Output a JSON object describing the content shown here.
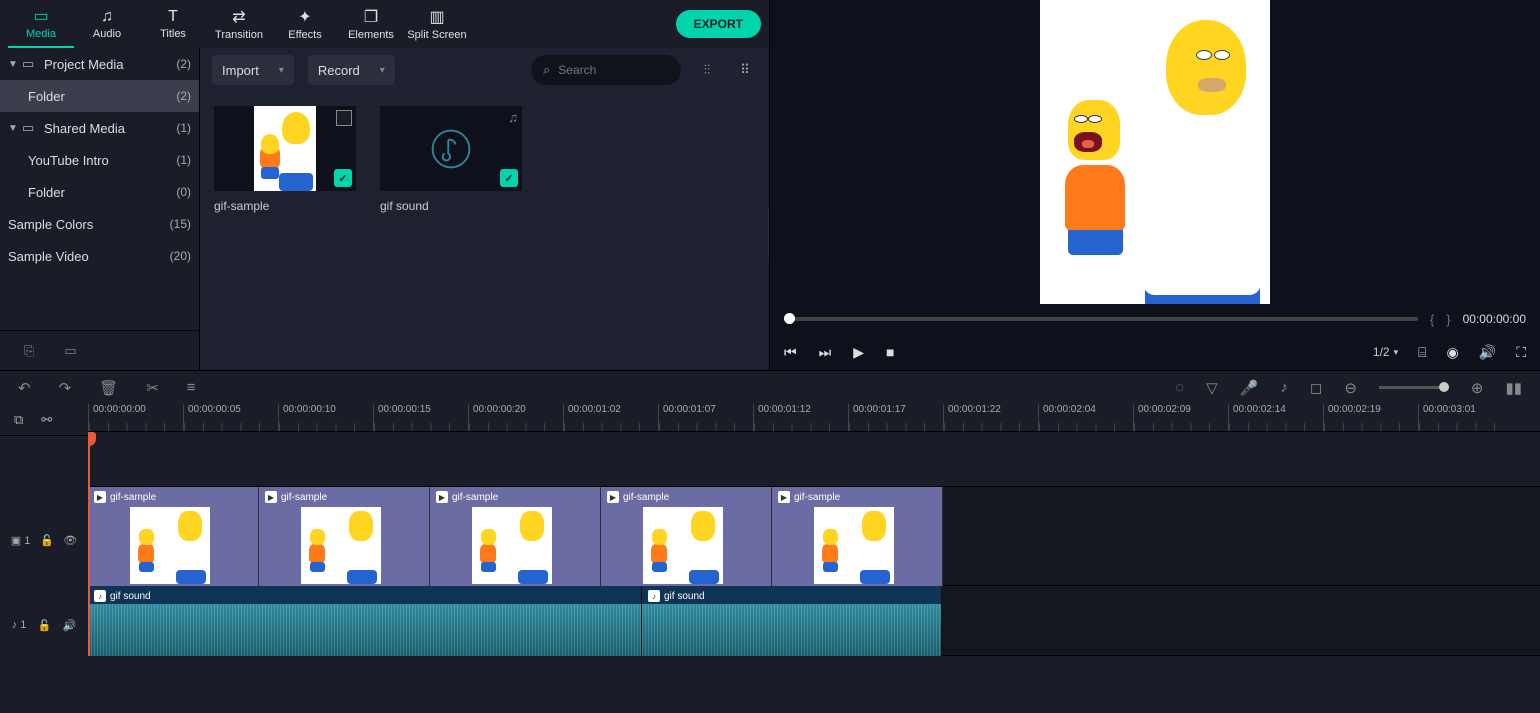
{
  "tabs": [
    {
      "label": "Media",
      "icon": "folder"
    },
    {
      "label": "Audio",
      "icon": "music"
    },
    {
      "label": "Titles",
      "icon": "text"
    },
    {
      "label": "Transition",
      "icon": "transition"
    },
    {
      "label": "Effects",
      "icon": "sparkle"
    },
    {
      "label": "Elements",
      "icon": "shapes"
    },
    {
      "label": "Split Screen",
      "icon": "split"
    }
  ],
  "active_tab": "Media",
  "export_label": "EXPORT",
  "sidebar": {
    "items": [
      {
        "label": "Project Media",
        "count": "(2)",
        "hasCaret": true,
        "hasFolder": true
      },
      {
        "label": "Folder",
        "count": "(2)",
        "isChild": true,
        "active": true
      },
      {
        "label": "Shared Media",
        "count": "(1)",
        "hasCaret": true,
        "hasFolder": true
      },
      {
        "label": "YouTube Intro",
        "count": "(1)",
        "isChild": true
      },
      {
        "label": "Folder",
        "count": "(0)",
        "isChild": true
      },
      {
        "label": "Sample Colors",
        "count": "(15)"
      },
      {
        "label": "Sample Video",
        "count": "(20)"
      }
    ]
  },
  "media_toolbar": {
    "import": "Import",
    "record": "Record",
    "search_placeholder": "Search"
  },
  "media_items": [
    {
      "name": "gif-sample",
      "type": "video"
    },
    {
      "name": "gif sound",
      "type": "audio"
    }
  ],
  "preview": {
    "time": "00:00:00:00",
    "ratio": "1/2"
  },
  "ruler": [
    "00:00:00:00",
    "00:00:00:05",
    "00:00:00:10",
    "00:00:00:15",
    "00:00:00:20",
    "00:00:01:02",
    "00:00:01:07",
    "00:00:01:12",
    "00:00:01:17",
    "00:00:01:22",
    "00:00:02:04",
    "00:00:02:09",
    "00:00:02:14",
    "00:00:02:19",
    "00:00:03:01"
  ],
  "video_clips": [
    {
      "label": "gif-sample"
    },
    {
      "label": "gif-sample"
    },
    {
      "label": "gif-sample"
    },
    {
      "label": "gif-sample"
    },
    {
      "label": "gif-sample"
    }
  ],
  "audio_clips": [
    {
      "label": "gif sound"
    },
    {
      "label": "gif sound"
    }
  ],
  "track_labels": {
    "video": "▣ 1",
    "audio": "♪ 1"
  }
}
